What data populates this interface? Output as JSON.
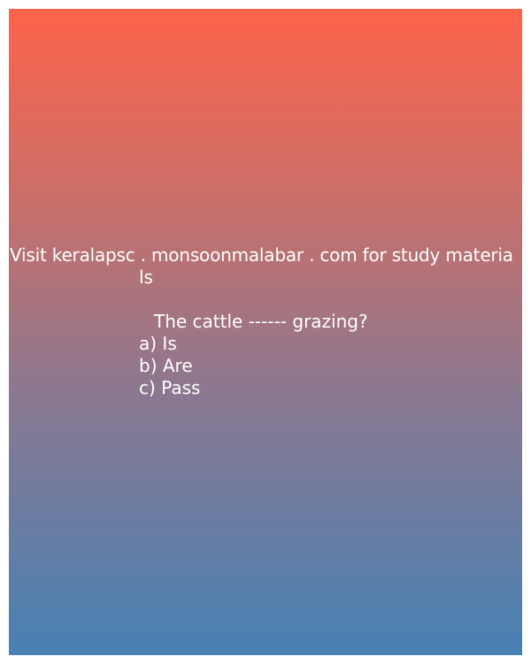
{
  "banner": {
    "line1": "Visit keralapsc . monsoonmalabar . com for study materia",
    "line2": "ls"
  },
  "quiz": {
    "question": "The cattle ------ grazing?",
    "options": [
      "a) Is",
      "b) Are",
      "c) Pass"
    ]
  },
  "colors": {
    "gradient_top": "#fd634a",
    "gradient_bottom": "#4781b4",
    "text": "#ffffff"
  }
}
